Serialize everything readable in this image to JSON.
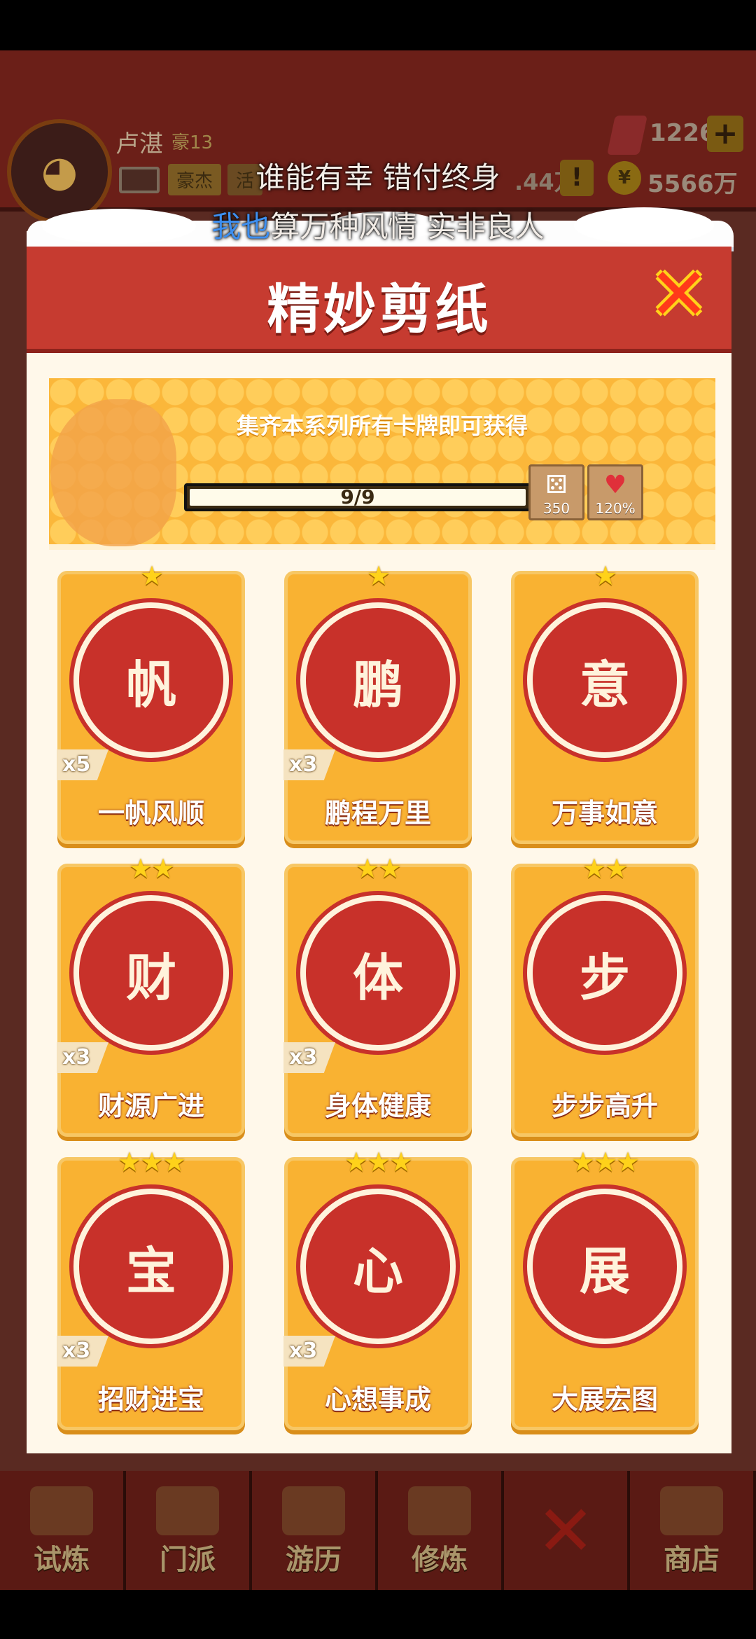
{
  "header": {
    "player_name": "卢湛",
    "player_level": "豪13",
    "tags": [
      "豪杰",
      "活"
    ],
    "gems": "1226",
    "income": ".44万",
    "coins": "5566万"
  },
  "lyrics": {
    "line1": "谁能有幸 错付终身",
    "line2_highlight": "我也",
    "line2_rest": "算万种风情 实非良人"
  },
  "modal": {
    "title": "精妙剪纸",
    "close_icon": "close-x-icon",
    "banner_text": "集齐本系列所有卡牌即可获得",
    "progress": {
      "current": 9,
      "total": 9,
      "label": "9/9"
    },
    "rewards": [
      {
        "icon": "dice-icon",
        "glyph": "⚄",
        "value": "350"
      },
      {
        "icon": "heart-icon",
        "glyph": "♥",
        "value": "120%"
      }
    ]
  },
  "cards": [
    {
      "name": "一帆风顺",
      "stars": "★",
      "count": "x5",
      "glyph": "帆"
    },
    {
      "name": "鹏程万里",
      "stars": "★",
      "count": "x3",
      "glyph": "鹏"
    },
    {
      "name": "万事如意",
      "stars": "★",
      "count": "",
      "glyph": "意"
    },
    {
      "name": "财源广进",
      "stars": "★★",
      "count": "x3",
      "glyph": "财"
    },
    {
      "name": "身体健康",
      "stars": "★★",
      "count": "x3",
      "glyph": "体"
    },
    {
      "name": "步步高升",
      "stars": "★★",
      "count": "",
      "glyph": "步"
    },
    {
      "name": "招财进宝",
      "stars": "★★★",
      "count": "x3",
      "glyph": "宝"
    },
    {
      "name": "心想事成",
      "stars": "★★★",
      "count": "x3",
      "glyph": "心"
    },
    {
      "name": "大展宏图",
      "stars": "★★★",
      "count": "",
      "glyph": "展"
    }
  ],
  "bottom_nav": {
    "items": [
      "试炼",
      "门派",
      "游历",
      "修炼",
      "",
      "商店"
    ]
  },
  "colors": {
    "header_red": "#c63b30",
    "card_gold": "#f9b232",
    "paper_red": "#c8312a",
    "close_red": "#ff3a1a"
  }
}
